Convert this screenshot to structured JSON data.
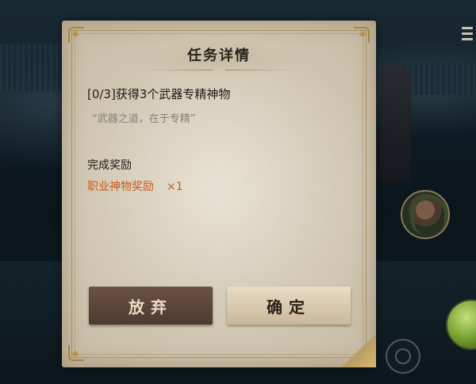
{
  "dialog": {
    "title": "任务详情",
    "quest": {
      "progress_and_name": "[0/3]获得3个武器专精神物",
      "quote": "“武器之道，在于专精”"
    },
    "reward": {
      "heading": "完成奖励",
      "item_name": "职业神物奖励",
      "item_qty": "×1",
      "item_color": "#cc5a1e"
    },
    "buttons": {
      "abandon": "放弃",
      "confirm": "确定"
    }
  },
  "hud": {
    "icons": [
      "menu-icon",
      "hero-portrait",
      "skill-orb",
      "joystick-button"
    ]
  }
}
